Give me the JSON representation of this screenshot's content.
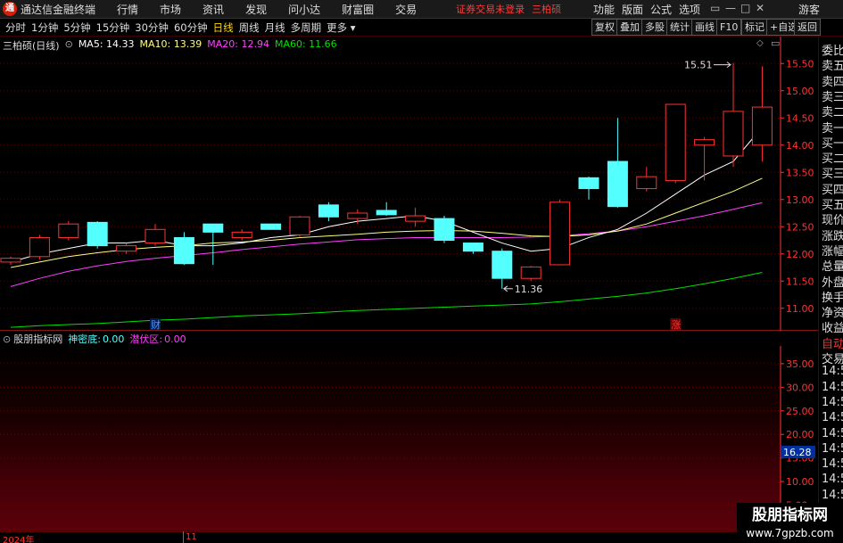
{
  "app": {
    "title": "通达信金融终端",
    "logo_char": "通",
    "menu": [
      "行情",
      "市场",
      "资讯",
      "发现",
      "问小达",
      "财富圈",
      "交易"
    ],
    "login_status": "证券交易未登录",
    "stock_name": "三柏硕",
    "right_menu": [
      "功能",
      "版面",
      "公式",
      "选项"
    ],
    "window_buttons": [
      "▭",
      "—",
      "□",
      "✕"
    ],
    "guest": "游客"
  },
  "toolbar": {
    "periods": [
      "分时",
      "1分钟",
      "5分钟",
      "15分钟",
      "30分钟",
      "60分钟",
      "日线",
      "周线",
      "月线",
      "多周期",
      "更多"
    ],
    "active_period": "日线",
    "buttons": [
      "复权",
      "叠加",
      "多股",
      "统计",
      "画线",
      "F10",
      "标记",
      "+自选",
      "返回"
    ]
  },
  "legend": {
    "stock_label": "三柏硕(日线)",
    "ma5": "MA5: 14.33",
    "ma10": "MA10: 13.39",
    "ma20": "MA20: 12.94",
    "ma60": "MA60: 11.66"
  },
  "colors": {
    "up": "#ff3232",
    "down": "#54ffff",
    "ma5": "#ffffff",
    "ma10": "#ffff80",
    "ma20": "#ff40ff",
    "ma60": "#00e000",
    "axis": "#ff3232"
  },
  "chart_data": {
    "type": "candlestick",
    "y_ticks": [
      "15.50",
      "15.00",
      "14.50",
      "14.00",
      "13.50",
      "13.00",
      "12.50",
      "12.00",
      "11.50",
      "11.00"
    ],
    "ylim": [
      10.75,
      15.75
    ],
    "candles": [
      {
        "o": 11.85,
        "h": 11.95,
        "l": 11.8,
        "c": 11.92
      },
      {
        "o": 11.95,
        "h": 12.35,
        "l": 11.9,
        "c": 12.3
      },
      {
        "o": 12.3,
        "h": 12.6,
        "l": 12.25,
        "c": 12.55
      },
      {
        "o": 12.58,
        "h": 12.6,
        "l": 12.1,
        "c": 12.15
      },
      {
        "o": 12.05,
        "h": 12.2,
        "l": 12.0,
        "c": 12.15
      },
      {
        "o": 12.2,
        "h": 12.55,
        "l": 12.15,
        "c": 12.45
      },
      {
        "o": 12.3,
        "h": 12.4,
        "l": 11.8,
        "c": 11.82
      },
      {
        "o": 12.55,
        "h": 12.55,
        "l": 11.8,
        "c": 12.4
      },
      {
        "o": 12.3,
        "h": 12.45,
        "l": 12.25,
        "c": 12.4
      },
      {
        "o": 12.55,
        "h": 12.5,
        "l": 12.45,
        "c": 12.45
      },
      {
        "o": 12.35,
        "h": 12.7,
        "l": 12.3,
        "c": 12.68
      },
      {
        "o": 12.9,
        "h": 12.95,
        "l": 12.6,
        "c": 12.68
      },
      {
        "o": 12.65,
        "h": 12.82,
        "l": 12.55,
        "c": 12.75
      },
      {
        "o": 12.8,
        "h": 12.95,
        "l": 12.7,
        "c": 12.72
      },
      {
        "o": 12.6,
        "h": 12.85,
        "l": 12.5,
        "c": 12.7
      },
      {
        "o": 12.65,
        "h": 12.7,
        "l": 12.2,
        "c": 12.25
      },
      {
        "o": 12.2,
        "h": 12.2,
        "l": 12.0,
        "c": 12.05
      },
      {
        "o": 12.05,
        "h": 12.1,
        "l": 11.36,
        "c": 11.55
      },
      {
        "o": 11.55,
        "h": 11.78,
        "l": 11.5,
        "c": 11.76
      },
      {
        "o": 11.8,
        "h": 13.0,
        "l": 11.8,
        "c": 12.95
      },
      {
        "o": 13.4,
        "h": 13.42,
        "l": 13.0,
        "c": 13.2
      },
      {
        "o": 13.7,
        "h": 14.5,
        "l": 12.85,
        "c": 12.87
      },
      {
        "o": 13.2,
        "h": 13.6,
        "l": 13.15,
        "c": 13.42
      },
      {
        "o": 13.35,
        "h": 14.75,
        "l": 13.3,
        "c": 14.75
      },
      {
        "o": 14.0,
        "h": 14.15,
        "l": 13.35,
        "c": 14.1
      },
      {
        "o": 13.8,
        "h": 15.51,
        "l": 13.6,
        "c": 14.62
      },
      {
        "o": 14.0,
        "h": 15.45,
        "l": 13.7,
        "c": 14.7
      }
    ],
    "ma5": [
      11.85,
      12.0,
      12.1,
      12.2,
      12.2,
      12.25,
      12.15,
      12.15,
      12.2,
      12.3,
      12.35,
      12.5,
      12.6,
      12.65,
      12.7,
      12.6,
      12.4,
      12.2,
      12.05,
      12.1,
      12.3,
      12.45,
      12.75,
      13.1,
      13.45,
      13.7,
      14.33
    ],
    "ma10": [
      11.75,
      11.85,
      11.95,
      12.02,
      12.08,
      12.12,
      12.15,
      12.2,
      12.22,
      12.25,
      12.3,
      12.33,
      12.36,
      12.4,
      12.42,
      12.43,
      12.42,
      12.38,
      12.33,
      12.32,
      12.35,
      12.42,
      12.55,
      12.75,
      12.95,
      13.15,
      13.39
    ],
    "ma20": [
      11.4,
      11.55,
      11.68,
      11.78,
      11.86,
      11.92,
      11.97,
      12.02,
      12.08,
      12.13,
      12.18,
      12.22,
      12.26,
      12.28,
      12.3,
      12.3,
      12.3,
      12.3,
      12.31,
      12.33,
      12.37,
      12.42,
      12.5,
      12.6,
      12.7,
      12.82,
      12.94
    ],
    "ma60": [
      10.65,
      10.68,
      10.7,
      10.72,
      10.75,
      10.78,
      10.8,
      10.83,
      10.86,
      10.88,
      10.9,
      10.93,
      10.96,
      10.98,
      11.0,
      11.02,
      11.04,
      11.06,
      11.08,
      11.12,
      11.17,
      11.22,
      11.28,
      11.36,
      11.45,
      11.55,
      11.66
    ],
    "high_label": "15.51",
    "low_label": "11.36",
    "event_markers": [
      {
        "index": 5,
        "text": "财",
        "color": "#3fa0ff"
      },
      {
        "index": 23,
        "text": "涨",
        "color": "#ff3232"
      }
    ]
  },
  "side_panel": {
    "labels": [
      "委比",
      "卖五",
      "卖四",
      "卖三",
      "卖二",
      "卖一",
      "买一",
      "买二",
      "买三",
      "买四",
      "买五",
      "现价",
      "涨跌",
      "涨幅",
      "总量",
      "外盘",
      "换手",
      "净资",
      "收益",
      "自动",
      "交易",
      "14:56",
      "14:56",
      "14:56",
      "14:56",
      "14:56",
      "14:56",
      "14:56",
      "14:56",
      "14:56",
      "14:56",
      "14:56"
    ]
  },
  "indicator": {
    "name": "股朋指标网",
    "field1_label": "神密底:",
    "field1_value": "0.00",
    "field2_label": "潜伏区:",
    "field2_value": "0.00",
    "y_ticks": [
      "35.00",
      "30.00",
      "25.00",
      "20.00",
      "15.00",
      "10.00",
      "5.00"
    ],
    "ylim": [
      0,
      38
    ],
    "current_value": "16.28"
  },
  "timeline": {
    "labels": [
      "2024年",
      "11"
    ]
  },
  "watermark": {
    "main": "股朋指标网",
    "sub": "www.7gpzb.com"
  }
}
